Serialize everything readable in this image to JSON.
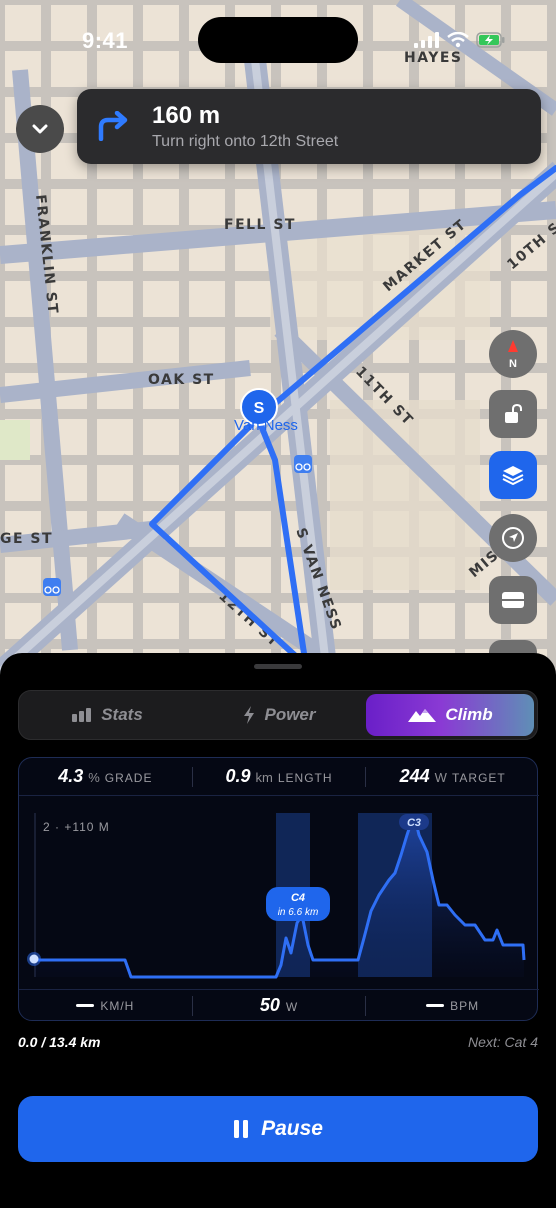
{
  "status_bar": {
    "time": "9:41"
  },
  "navigation": {
    "distance": "160 m",
    "instruction": "Turn right onto 12th Street"
  },
  "map": {
    "streets": [
      "FRANKLIN ST",
      "FELL ST",
      "MARKET ST",
      "10TH S",
      "OAK ST",
      "11TH ST",
      "S VAN NESS",
      "GE ST",
      "12TH ST",
      "MIS",
      "HAYES"
    ],
    "station_marker": "S",
    "station_label": "Van Ness",
    "compass_label": "N"
  },
  "tabs": [
    {
      "label": "Stats",
      "icon": "bar-chart-icon"
    },
    {
      "label": "Power",
      "icon": "bolt-icon"
    },
    {
      "label": "Climb",
      "icon": "mountain-icon"
    }
  ],
  "climb_stats": {
    "grade_value": "4.3",
    "grade_unit": "%",
    "grade_label": "GRADE",
    "length_value": "0.9",
    "length_unit": "km",
    "length_label": "LENGTH",
    "target_value": "244",
    "target_unit": "W",
    "target_label": "TARGET"
  },
  "elevation": {
    "summary": "2 · +110 M",
    "climbs": [
      {
        "category": "C4",
        "note": "in 6.6 km"
      },
      {
        "category": "C3"
      }
    ]
  },
  "live_metrics": {
    "speed_label": "KM/H",
    "power_value": "50",
    "power_label": "W",
    "hr_label": "BPM"
  },
  "route_progress": {
    "text": "0.0 / 13.4 km",
    "next": "Next: Cat 4"
  },
  "pause_label": "Pause",
  "colors": {
    "accent_blue": "#1f66ec",
    "climb_gradient_start": "#6a1fc8",
    "route_blue": "#2f6ff5"
  }
}
